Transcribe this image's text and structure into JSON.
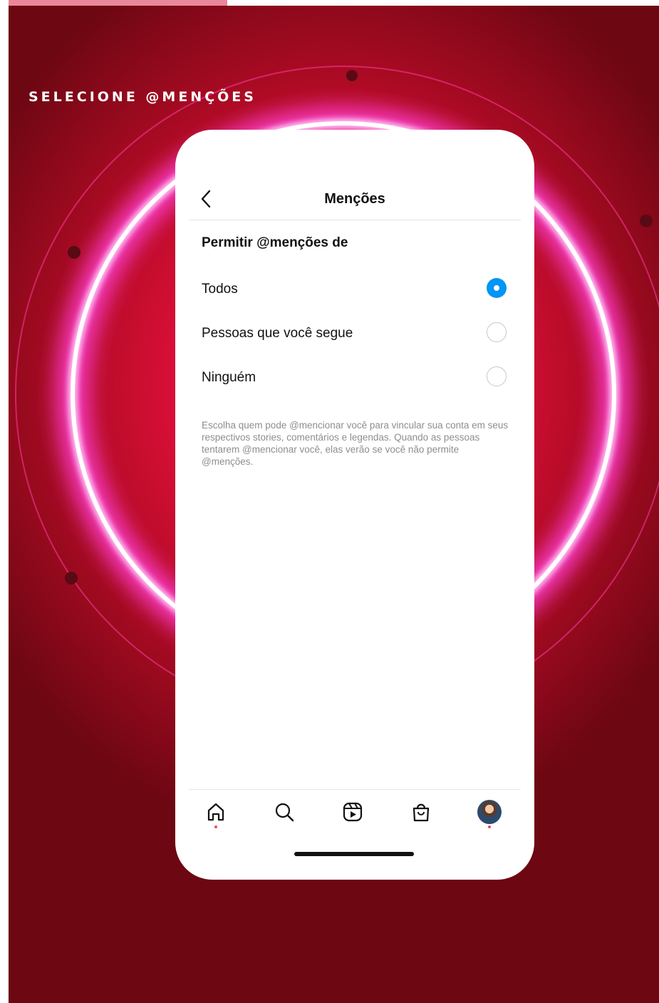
{
  "caption": "SELECIONE @MENÇÕES",
  "header": {
    "title": "Menções",
    "back_icon": "chevron-left-icon"
  },
  "section": {
    "title": "Permitir @menções de"
  },
  "options": [
    {
      "label": "Todos",
      "selected": true
    },
    {
      "label": "Pessoas que você segue",
      "selected": false
    },
    {
      "label": "Ninguém",
      "selected": false
    }
  ],
  "help_text": "Escolha quem pode @mencionar você para vincular sua conta em seus respectivos stories, comentários e legendas. Quando as pessoas tentarem @mencionar você, elas verão se você não permite @menções.",
  "tabbar": {
    "items": [
      {
        "icon": "home-icon",
        "notification_dot": true
      },
      {
        "icon": "search-icon",
        "notification_dot": false
      },
      {
        "icon": "reels-icon",
        "notification_dot": false
      },
      {
        "icon": "shop-icon",
        "notification_dot": false
      },
      {
        "icon": "profile-avatar",
        "notification_dot": true
      }
    ]
  },
  "colors": {
    "accent_blue": "#0095f6",
    "notification_red": "#ed4956",
    "backdrop_red": "#e0103a",
    "neon_pink": "#ff5ad8"
  }
}
